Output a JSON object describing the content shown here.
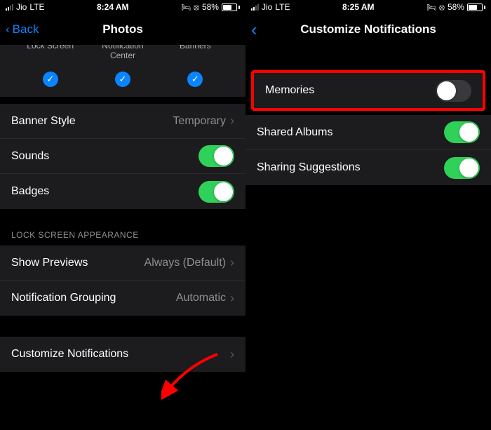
{
  "left": {
    "status": {
      "carrier": "Jio",
      "network": "LTE",
      "time": "8:24 AM",
      "battery": "58%"
    },
    "nav": {
      "back": "Back",
      "title": "Photos"
    },
    "alerts": {
      "lockscreen": "Lock Screen",
      "center": "Notification Center",
      "banners": "Banners"
    },
    "banner_style": {
      "label": "Banner Style",
      "value": "Temporary"
    },
    "sounds": {
      "label": "Sounds"
    },
    "badges": {
      "label": "Badges"
    },
    "section_lsa": "LOCK SCREEN APPEARANCE",
    "show_previews": {
      "label": "Show Previews",
      "value": "Always (Default)"
    },
    "grouping": {
      "label": "Notification Grouping",
      "value": "Automatic"
    },
    "customize": {
      "label": "Customize Notifications"
    }
  },
  "right": {
    "status": {
      "carrier": "Jio",
      "network": "LTE",
      "time": "8:25 AM",
      "battery": "58%"
    },
    "nav": {
      "title": "Customize Notifications"
    },
    "memories": {
      "label": "Memories"
    },
    "shared_albums": {
      "label": "Shared Albums"
    },
    "sharing_suggestions": {
      "label": "Sharing Suggestions"
    }
  }
}
